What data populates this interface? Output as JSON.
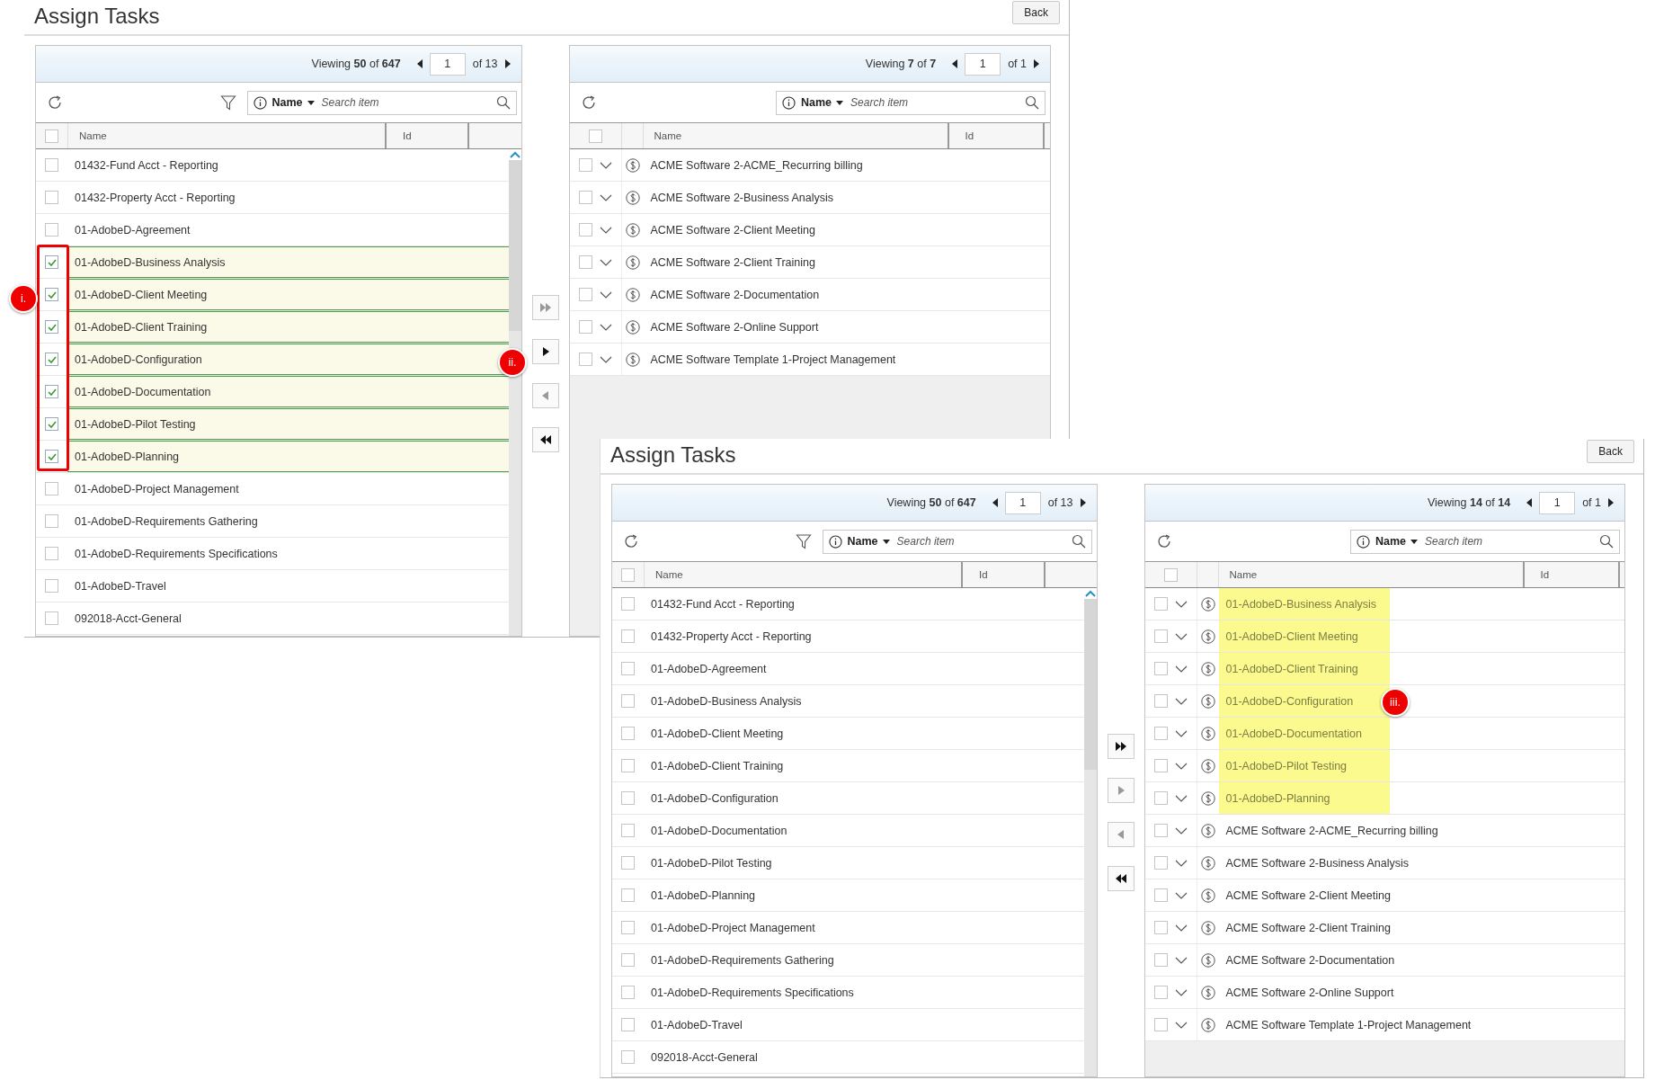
{
  "screens": [
    {
      "title": "Assign Tasks",
      "back": "Back",
      "panels": [
        {
          "kind": "source",
          "viewing": "Viewing **50** of **647**",
          "page": "1",
          "pages": "of 13",
          "field": "Name",
          "placeholder": "Search item",
          "columns": [
            "Name",
            "Id"
          ],
          "header_checked": false,
          "rows": [
            {
              "name": "01432-Fund Acct - Reporting",
              "checked": false
            },
            {
              "name": "01432-Property Acct - Reporting",
              "checked": false
            },
            {
              "name": "01-AdobeD-Agreement",
              "checked": false
            },
            {
              "name": "01-AdobeD-Business Analysis",
              "checked": true
            },
            {
              "name": "01-AdobeD-Client Meeting",
              "checked": true
            },
            {
              "name": "01-AdobeD-Client Training",
              "checked": true
            },
            {
              "name": "01-AdobeD-Configuration",
              "checked": true
            },
            {
              "name": "01-AdobeD-Documentation",
              "checked": true
            },
            {
              "name": "01-AdobeD-Pilot Testing",
              "checked": true
            },
            {
              "name": "01-AdobeD-Planning",
              "checked": true
            },
            {
              "name": "01-AdobeD-Project Management",
              "checked": false
            },
            {
              "name": "01-AdobeD-Requirements Gathering",
              "checked": false
            },
            {
              "name": "01-AdobeD-Requirements Specifications",
              "checked": false
            },
            {
              "name": "01-AdobeD-Travel",
              "checked": false
            },
            {
              "name": "092018-Acct-General",
              "checked": false
            }
          ]
        },
        {
          "kind": "target",
          "viewing": "Viewing **7** of **7**",
          "page": "1",
          "pages": "of 1",
          "field": "Name",
          "placeholder": "Search item",
          "columns": [
            "Name",
            "Id"
          ],
          "header_checked": false,
          "rows": [
            {
              "name": "ACME Software 2-ACME_Recurring billing",
              "checked": false,
              "highlighted": false
            },
            {
              "name": "ACME Software 2-Business Analysis",
              "checked": false,
              "highlighted": false
            },
            {
              "name": "ACME Software 2-Client Meeting",
              "checked": false,
              "highlighted": false
            },
            {
              "name": "ACME Software 2-Client Training",
              "checked": false,
              "highlighted": false
            },
            {
              "name": "ACME Software 2-Documentation",
              "checked": false,
              "highlighted": false
            },
            {
              "name": "ACME Software 2-Online Support",
              "checked": false,
              "highlighted": false
            },
            {
              "name": "ACME Software Template 1-Project Management",
              "checked": false,
              "highlighted": false
            }
          ]
        }
      ],
      "transfer": [
        {
          "kind": "all-right",
          "disabled": true
        },
        {
          "kind": "right",
          "disabled": false
        },
        {
          "kind": "left",
          "disabled": true
        },
        {
          "kind": "all-left",
          "disabled": false
        }
      ],
      "callouts": [
        {
          "label": "i.",
          "frame": true
        },
        {
          "label": "ii.",
          "frame": false
        }
      ]
    },
    {
      "title": "Assign Tasks",
      "back": "Back",
      "panels": [
        {
          "kind": "source",
          "viewing": "Viewing **50** of **647**",
          "page": "1",
          "pages": "of 13",
          "field": "Name",
          "placeholder": "Search item",
          "columns": [
            "Name",
            "Id"
          ],
          "header_checked": false,
          "rows": [
            {
              "name": "01432-Fund Acct - Reporting",
              "checked": false
            },
            {
              "name": "01432-Property Acct - Reporting",
              "checked": false
            },
            {
              "name": "01-AdobeD-Agreement",
              "checked": false
            },
            {
              "name": "01-AdobeD-Business Analysis",
              "checked": false
            },
            {
              "name": "01-AdobeD-Client Meeting",
              "checked": false
            },
            {
              "name": "01-AdobeD-Client Training",
              "checked": false
            },
            {
              "name": "01-AdobeD-Configuration",
              "checked": false
            },
            {
              "name": "01-AdobeD-Documentation",
              "checked": false
            },
            {
              "name": "01-AdobeD-Pilot Testing",
              "checked": false
            },
            {
              "name": "01-AdobeD-Planning",
              "checked": false
            },
            {
              "name": "01-AdobeD-Project Management",
              "checked": false
            },
            {
              "name": "01-AdobeD-Requirements Gathering",
              "checked": false
            },
            {
              "name": "01-AdobeD-Requirements Specifications",
              "checked": false
            },
            {
              "name": "01-AdobeD-Travel",
              "checked": false
            },
            {
              "name": "092018-Acct-General",
              "checked": false
            }
          ]
        },
        {
          "kind": "target",
          "viewing": "Viewing **14** of **14**",
          "page": "1",
          "pages": "of 1",
          "field": "Name",
          "placeholder": "Search item",
          "columns": [
            "Name",
            "Id"
          ],
          "header_checked": false,
          "rows": [
            {
              "name": "01-AdobeD-Business Analysis",
              "checked": false,
              "highlighted": true
            },
            {
              "name": "01-AdobeD-Client Meeting",
              "checked": false,
              "highlighted": true
            },
            {
              "name": "01-AdobeD-Client Training",
              "checked": false,
              "highlighted": true
            },
            {
              "name": "01-AdobeD-Configuration",
              "checked": false,
              "highlighted": true
            },
            {
              "name": "01-AdobeD-Documentation",
              "checked": false,
              "highlighted": true
            },
            {
              "name": "01-AdobeD-Pilot Testing",
              "checked": false,
              "highlighted": true
            },
            {
              "name": "01-AdobeD-Planning",
              "checked": false,
              "highlighted": true
            },
            {
              "name": "ACME Software 2-ACME_Recurring billing",
              "checked": false,
              "highlighted": false
            },
            {
              "name": "ACME Software 2-Business Analysis",
              "checked": false,
              "highlighted": false
            },
            {
              "name": "ACME Software 2-Client Meeting",
              "checked": false,
              "highlighted": false
            },
            {
              "name": "ACME Software 2-Client Training",
              "checked": false,
              "highlighted": false
            },
            {
              "name": "ACME Software 2-Documentation",
              "checked": false,
              "highlighted": false
            },
            {
              "name": "ACME Software 2-Online Support",
              "checked": false,
              "highlighted": false
            },
            {
              "name": "ACME Software Template 1-Project Management",
              "checked": false,
              "highlighted": false
            }
          ]
        }
      ],
      "transfer": [
        {
          "kind": "all-right",
          "disabled": false
        },
        {
          "kind": "right",
          "disabled": true
        },
        {
          "kind": "left",
          "disabled": true
        },
        {
          "kind": "all-left",
          "disabled": false
        }
      ],
      "callouts": [
        {
          "label": "iii.",
          "frame": false
        }
      ]
    }
  ]
}
